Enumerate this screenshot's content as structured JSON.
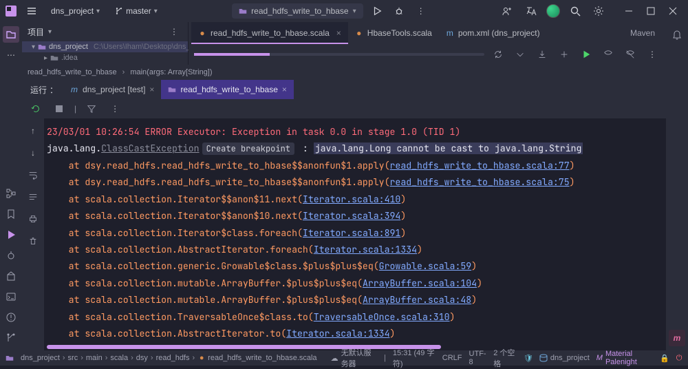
{
  "titlebar": {
    "project": "dns_project",
    "branch": "master",
    "current_file": "read_hdfs_write_to_hbase"
  },
  "project_panel": {
    "header": "项目",
    "root": "dns_project",
    "root_path": "C:\\Users\\Iham\\Desktop\\dns_project",
    "child": ".idea"
  },
  "editor_tabs": [
    {
      "label": "read_hdfs_write_to_hbase.scala",
      "icon": "scala",
      "active": true
    },
    {
      "label": "HbaseTools.scala",
      "icon": "scala",
      "active": false
    },
    {
      "label": "pom.xml (dns_project)",
      "icon": "pom",
      "active": false
    }
  ],
  "maven_label": "Maven",
  "breadcrumb": {
    "file": "read_hdfs_write_to_hbase",
    "method": "main(args: Array[String])"
  },
  "run_panel": {
    "label": "运行",
    "tabs": [
      {
        "label": "dns_project [test]",
        "icon": "m",
        "active": false
      },
      {
        "label": "read_hdfs_write_to_hbase",
        "icon": "folder",
        "active": true
      }
    ]
  },
  "console": {
    "header": "23/03/01 10:26:54 ERROR Executor: Exception in task 0.0 in stage 1.0 (TID 1)",
    "exc_prefix": "java.lang.",
    "exc_class": "ClassCastException",
    "bp_label": "Create breakpoint",
    "exc_msg": "java.lang.Long cannot be cast to java.lang.String",
    "stack": [
      {
        "text": "at dsy.read_hdfs.read_hdfs_write_to_hbase$$anonfun$1.apply(",
        "link": "read_hdfs_write_to_hbase.scala:77",
        "suffix": ")"
      },
      {
        "text": "at dsy.read_hdfs.read_hdfs_write_to_hbase$$anonfun$1.apply(",
        "link": "read_hdfs_write_to_hbase.scala:75",
        "suffix": ")"
      },
      {
        "text": "at scala.collection.Iterator$$anon$11.next(",
        "link": "Iterator.scala:410",
        "suffix": ")"
      },
      {
        "text": "at scala.collection.Iterator$$anon$10.next(",
        "link": "Iterator.scala:394",
        "suffix": ")"
      },
      {
        "text": "at scala.collection.Iterator$class.foreach(",
        "link": "Iterator.scala:891",
        "suffix": ")"
      },
      {
        "text": "at scala.collection.AbstractIterator.foreach(",
        "link": "Iterator.scala:1334",
        "suffix": ")"
      },
      {
        "text": "at scala.collection.generic.Growable$class.$plus$plus$eq(",
        "link": "Growable.scala:59",
        "suffix": ")"
      },
      {
        "text": "at scala.collection.mutable.ArrayBuffer.$plus$plus$eq(",
        "link": "ArrayBuffer.scala:104",
        "suffix": ")"
      },
      {
        "text": "at scala.collection.mutable.ArrayBuffer.$plus$plus$eq(",
        "link": "ArrayBuffer.scala:48",
        "suffix": ")"
      },
      {
        "text": "at scala.collection.TraversableOnce$class.to(",
        "link": "TraversableOnce.scala:310",
        "suffix": ")"
      },
      {
        "text": "at scala.collection.AbstractIterator.to(",
        "link": "Iterator.scala:1334",
        "suffix": ")"
      }
    ]
  },
  "status": {
    "crumbs": [
      "dns_project",
      "src",
      "main",
      "scala",
      "dsy",
      "read_hdfs",
      "read_hdfs_write_to_hbase.scala"
    ],
    "host": "无默认服务器",
    "pos": "15:31 (49 字符)",
    "nl": "CRLF",
    "enc": "UTF-8",
    "indent": "2 个空格",
    "project": "dns_project",
    "theme": "Material Palenight"
  }
}
